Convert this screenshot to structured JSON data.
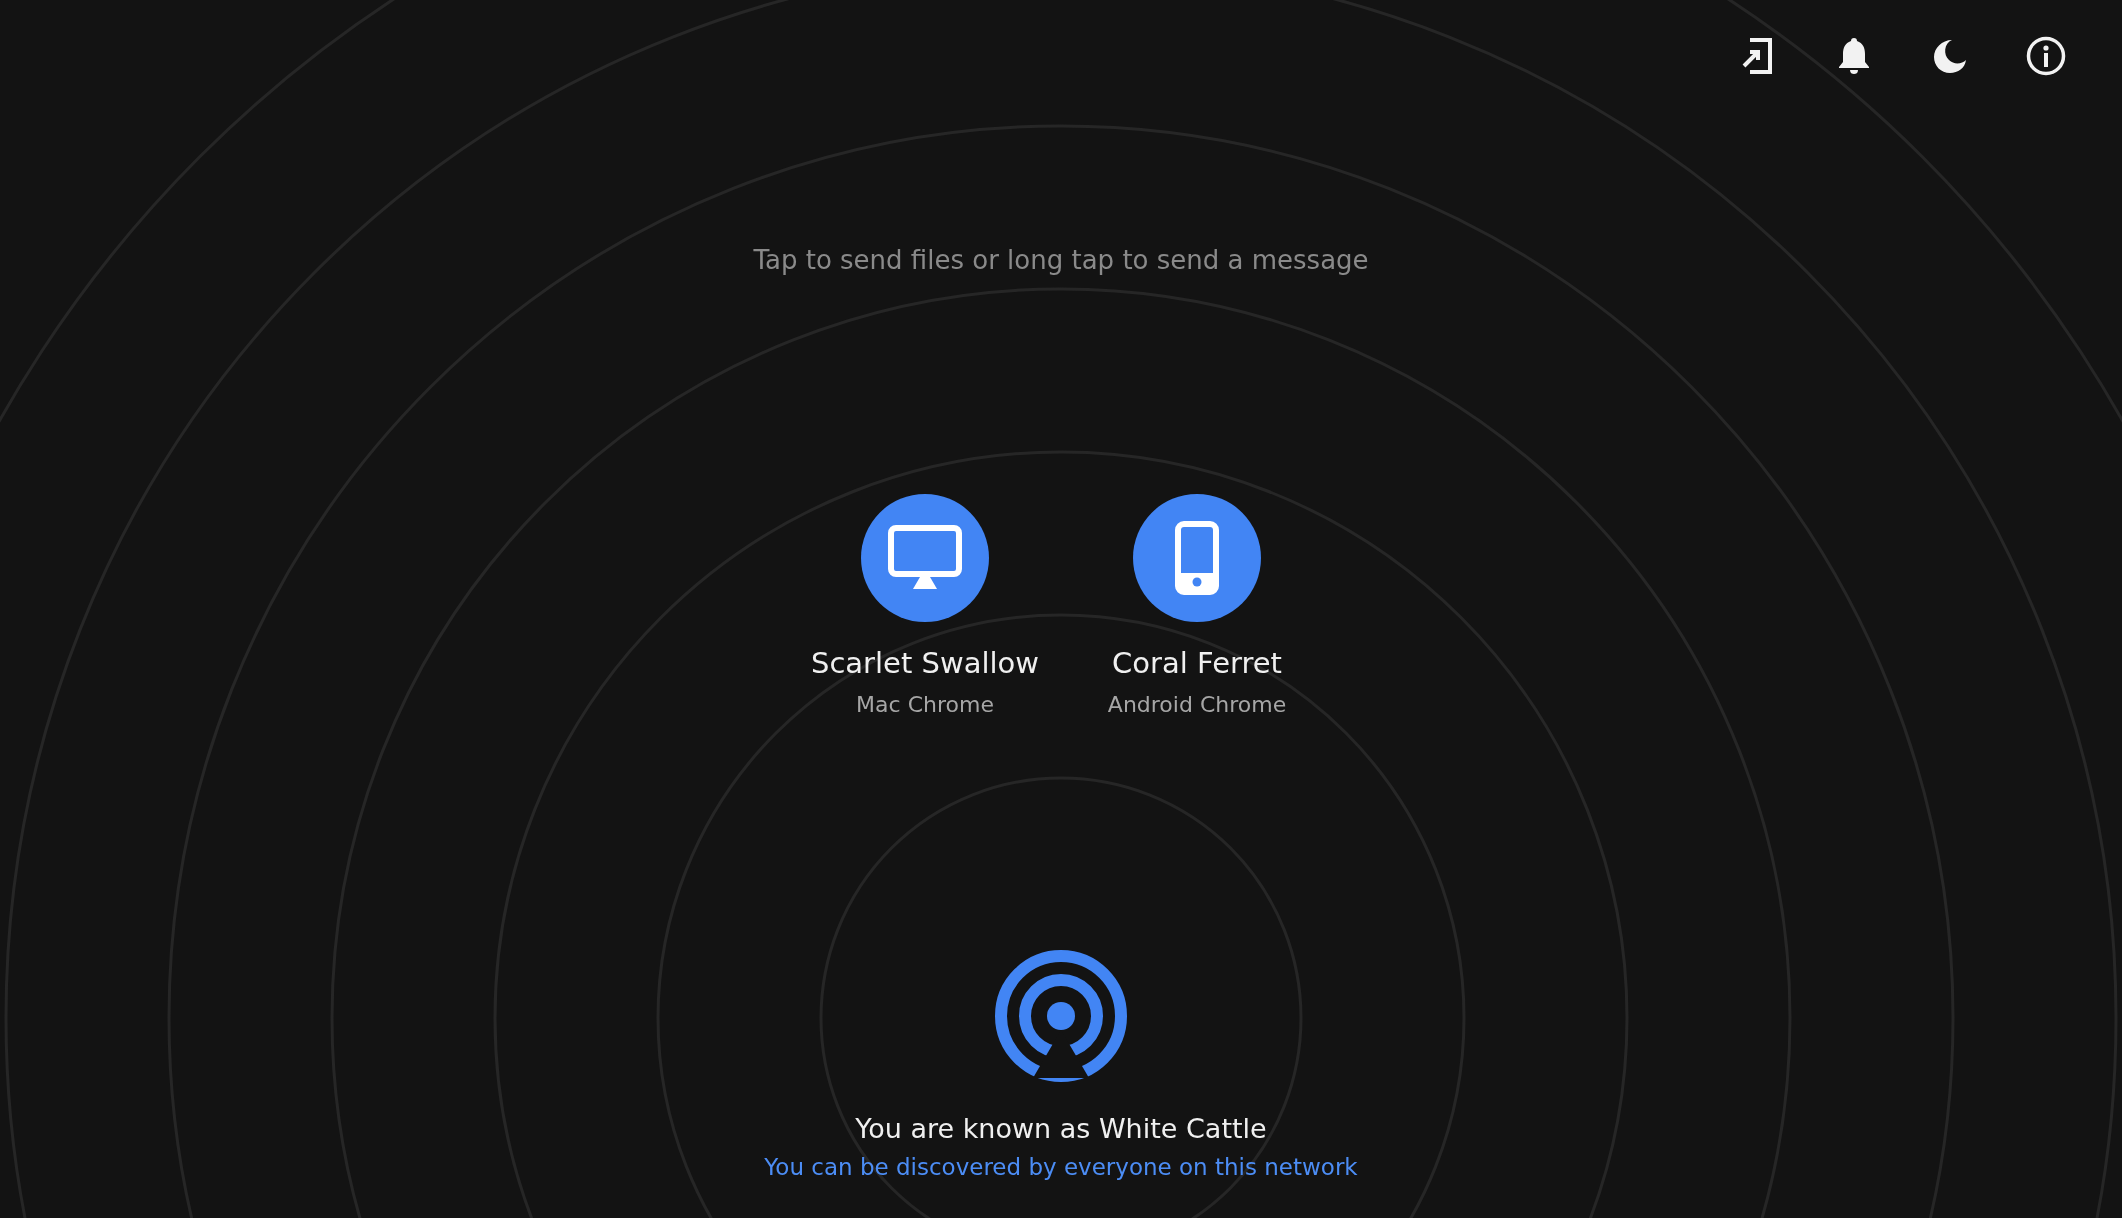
{
  "toolbar": {
    "buttons": [
      {
        "kind": "pair"
      },
      {
        "kind": "notifications"
      },
      {
        "kind": "theme"
      },
      {
        "kind": "info"
      }
    ]
  },
  "hint": "Tap to send files or long tap to send a message",
  "peers": [
    {
      "kind": "desktop",
      "name": "Scarlet Swallow",
      "device": "Mac Chrome"
    },
    {
      "kind": "mobile",
      "name": "Coral Ferret",
      "device": "Android Chrome"
    }
  ],
  "self": {
    "known_as": "You are known as White Cattle",
    "discovery": "You can be discovered by everyone on this network"
  }
}
